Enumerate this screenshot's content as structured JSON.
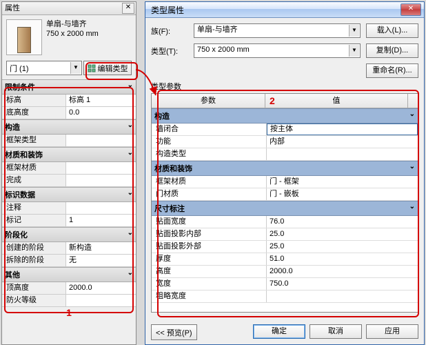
{
  "leftPanel": {
    "title": "属性",
    "family": {
      "name": "单扇-与墙齐",
      "size": "750 x 2000 mm"
    },
    "instanceSelector": "门 (1)",
    "editTypeButton": "编辑类型",
    "sections": [
      {
        "title": "限制条件",
        "rows": [
          {
            "label": "标高",
            "value": "标高 1"
          },
          {
            "label": "底高度",
            "value": "0.0"
          }
        ]
      },
      {
        "title": "构造",
        "rows": [
          {
            "label": "框架类型",
            "value": ""
          }
        ]
      },
      {
        "title": "材质和装饰",
        "rows": [
          {
            "label": "框架材质",
            "value": ""
          },
          {
            "label": "完成",
            "value": ""
          }
        ]
      },
      {
        "title": "标识数据",
        "rows": [
          {
            "label": "注释",
            "value": ""
          },
          {
            "label": "标记",
            "value": "1"
          }
        ]
      },
      {
        "title": "阶段化",
        "rows": [
          {
            "label": "创建的阶段",
            "value": "新构造"
          },
          {
            "label": "拆除的阶段",
            "value": "无"
          }
        ]
      },
      {
        "title": "其他",
        "rows": [
          {
            "label": "顶高度",
            "value": "2000.0"
          },
          {
            "label": "防火等级",
            "value": ""
          }
        ]
      }
    ],
    "anno": "1"
  },
  "dialog": {
    "title": "类型属性",
    "familyLabel": "族(F):",
    "familyValue": "单扇-与墙齐",
    "typeLabel": "类型(T):",
    "typeValue": "750 x 2000 mm",
    "loadBtn": "载入(L)...",
    "dupBtn": "复制(D)...",
    "renameBtn": "重命名(R)...",
    "tpLabel": "类型参数",
    "colParam": "参数",
    "colValue": "值",
    "anno": "2",
    "cats": [
      {
        "title": "构造",
        "rows": [
          {
            "label": "墙闭合",
            "value": "按主体",
            "selected": true
          },
          {
            "label": "功能",
            "value": "内部"
          },
          {
            "label": "构造类型",
            "value": ""
          }
        ]
      },
      {
        "title": "材质和装饰",
        "rows": [
          {
            "label": "框架材质",
            "value": "门 - 框架"
          },
          {
            "label": "门材质",
            "value": "门 - 嵌板"
          }
        ]
      },
      {
        "title": "尺寸标注",
        "rows": [
          {
            "label": "贴面宽度",
            "value": "76.0"
          },
          {
            "label": "贴面投影内部",
            "value": "25.0"
          },
          {
            "label": "贴面投影外部",
            "value": "25.0"
          },
          {
            "label": "厚度",
            "value": "51.0"
          },
          {
            "label": "高度",
            "value": "2000.0"
          },
          {
            "label": "宽度",
            "value": "750.0"
          },
          {
            "label": "粗略宽度",
            "value": ""
          }
        ]
      }
    ],
    "previewBtn": "<< 预览(P)",
    "okBtn": "确定",
    "cancelBtn": "取消",
    "applyBtn": "应用"
  }
}
